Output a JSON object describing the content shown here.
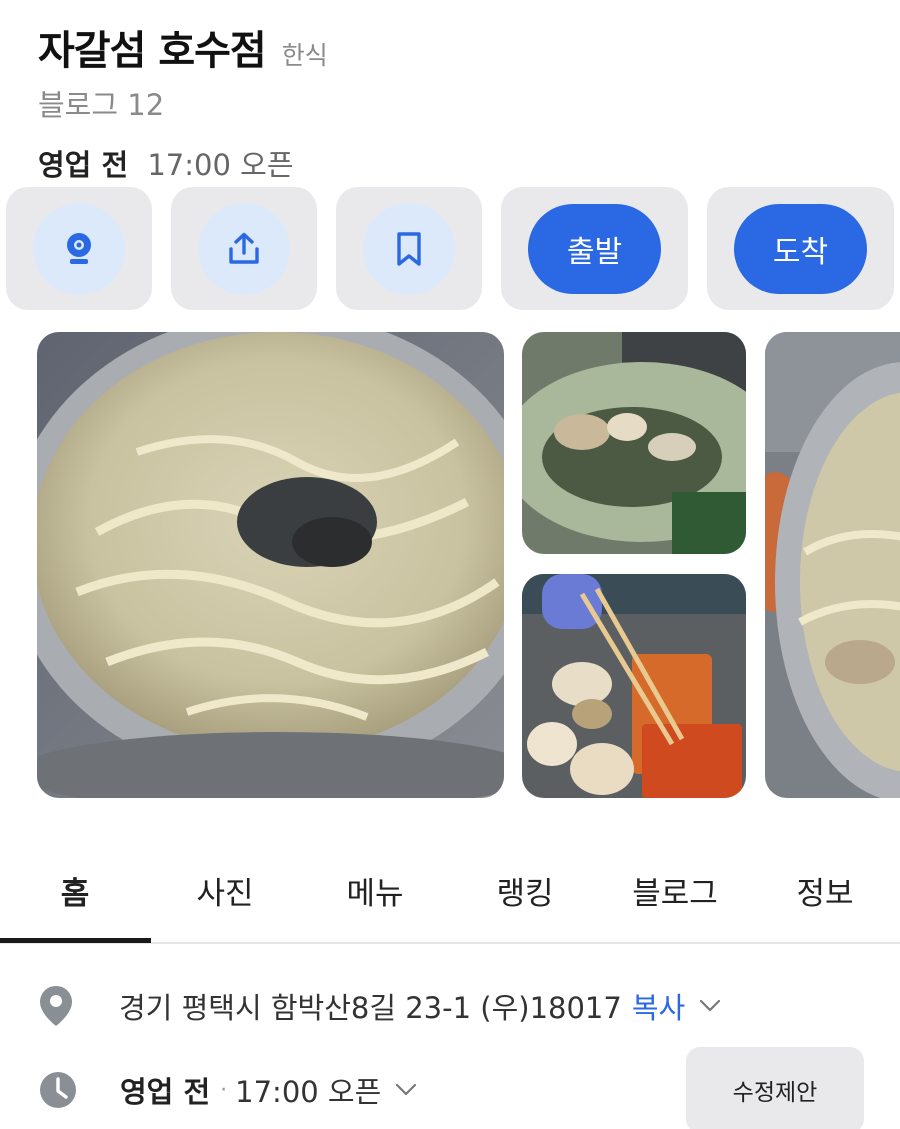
{
  "place": {
    "name": "자갈섬 호수점",
    "category": "한식",
    "blog_line": "블로그 12",
    "status": "영업 전",
    "open_time": "17:00 오픈"
  },
  "actions": {
    "icons": [
      "cctv-icon",
      "share-icon",
      "bookmark-icon"
    ],
    "depart_label": "출발",
    "arrive_label": "도착",
    "accent_color": "#2a69e3"
  },
  "tabs": [
    "홈",
    "사진",
    "메뉴",
    "랭킹",
    "블로그",
    "정보"
  ],
  "active_tab": "홈",
  "info": {
    "address": "경기 평택시 함박산8길 23-1 (우)18017",
    "copy_label": "복사",
    "hours_status": "영업 전",
    "hours_separator": "·",
    "hours_time": "17:00 오픈",
    "edit_label": "수정제안"
  }
}
